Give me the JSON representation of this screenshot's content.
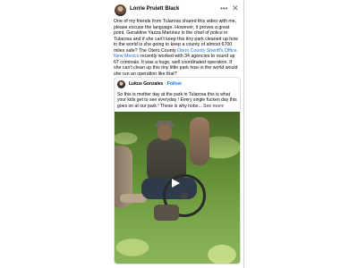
{
  "post": {
    "author": "Lorrie Pruiett Black",
    "text_before_link": "One of my friends from Tularosa shared this video with me, please excuse the language. However, it proves a great point. Geraldine Yazza Martinez is the chief of police in Tularosa and if she can't keep this tiny park cleaned up how in the world is she going to keep a county of almost 6700 miles safe? The Otero County ",
    "link_text": "Otero County Sheriff's Office, New Mexico",
    "text_after_link": " recently worked with 34 agencies to round up 67 criminals. It was a huge, well coordinated operation. If she can't clean up this tiny little park how in the world would she run an operation like that?"
  },
  "shared_post": {
    "author": "Lukus Gonzales",
    "separator": " · ",
    "follow_label": "Follow",
    "text": "So this is mother day at the park in Tularosa this is what your kids get to see everyday ! Every single fucken day this goes on at our park ! These is why nobo...",
    "see_more_label": " See more"
  },
  "icons": {
    "more": "more-options-icon",
    "close": "close-icon",
    "play": "play-icon"
  },
  "colors": {
    "link": "#1b74e4",
    "text": "#050505",
    "muted": "#65676b"
  }
}
